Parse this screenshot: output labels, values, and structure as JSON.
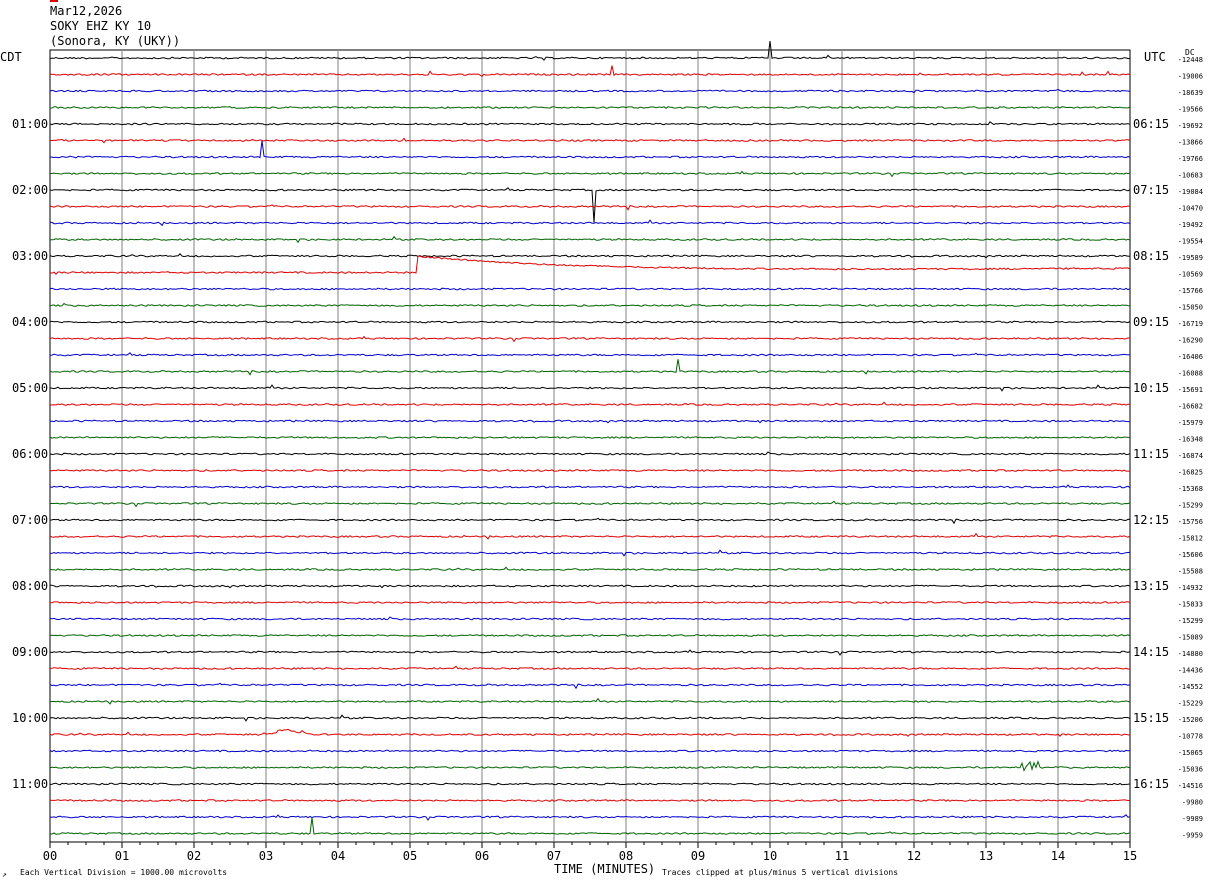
{
  "header": {
    "date": "Mar12,2026",
    "station": "SOKY EHZ KY 10",
    "location": "(Sonora, KY (UKY))"
  },
  "left_axis_title": "CDT",
  "right_axis_title": "UTC",
  "dc_label": "DC",
  "footer": {
    "scale_note": "Each Vertical Division = 1000.00 microvolts",
    "clip_note": "Traces clipped at plus/minus 5 vertical divisions",
    "corner_mark": "↗"
  },
  "colors": {
    "cycle": [
      "#000000",
      "#e00000",
      "#0000d0",
      "#006400"
    ],
    "grid": "#808080"
  },
  "chart_data": {
    "type": "line",
    "title": "SOKY EHZ KY 10",
    "xlabel": "TIME (MINUTES)",
    "x_ticks": [
      "00",
      "01",
      "02",
      "03",
      "04",
      "05",
      "06",
      "07",
      "08",
      "09",
      "10",
      "11",
      "12",
      "13",
      "14",
      "15"
    ],
    "xlim": [
      0,
      15
    ],
    "left_hour_labels": [
      "01:00",
      "02:00",
      "03:00",
      "04:00",
      "05:00",
      "06:00",
      "07:00",
      "08:00",
      "09:00",
      "10:00",
      "11:00"
    ],
    "right_hour_labels": [
      "06:15",
      "07:15",
      "08:15",
      "09:15",
      "10:15",
      "11:15",
      "12:15",
      "13:15",
      "14:15",
      "15:15",
      "16:15"
    ],
    "trace_offsets": [
      "-12448",
      "-19006",
      "-18639",
      "-19566",
      "-19692",
      "-13866",
      "-19766",
      "-10683",
      "-19084",
      "-10470",
      "-19492",
      "-19554",
      "-19589",
      "-10569",
      "-15766",
      "-15050",
      "-16719",
      "-16290",
      "-16406",
      "-16088",
      "-15691",
      "-16682",
      "-15979",
      "-16348",
      "-16874",
      "-16825",
      "-15368",
      "-15299",
      "-15756",
      "-15812",
      "-15606",
      "-15588",
      "-14932",
      "-15833",
      "-15299",
      "-15089",
      "-14880",
      "-14436",
      "-14552",
      "-15229",
      "-15206",
      "-10778",
      "-15065",
      "-15036",
      "-14516",
      "-9980",
      "-9989",
      "-9959"
    ],
    "events": [
      {
        "trace": 0,
        "minute": 9.99,
        "amplitude": -1.0,
        "kind": "spike"
      },
      {
        "trace": 1,
        "minute": 7.8,
        "amplitude": -0.5,
        "kind": "spike"
      },
      {
        "trace": 6,
        "minute": 2.95,
        "amplitude": -1.0,
        "kind": "step"
      },
      {
        "trace": 8,
        "minute": 7.56,
        "amplitude": 2.0,
        "kind": "drop"
      },
      {
        "trace": 13,
        "minute": 5.1,
        "amplitude": -1.0,
        "kind": "decay"
      },
      {
        "trace": 19,
        "minute": 8.72,
        "amplitude": -0.7,
        "kind": "spike"
      },
      {
        "trace": 41,
        "minute": 3.3,
        "amplitude": -0.3,
        "kind": "bump"
      },
      {
        "trace": 43,
        "minute": 13.62,
        "amplitude": 0.6,
        "kind": "burst"
      },
      {
        "trace": 47,
        "minute": 3.65,
        "amplitude": -1.0,
        "kind": "spike"
      }
    ]
  }
}
